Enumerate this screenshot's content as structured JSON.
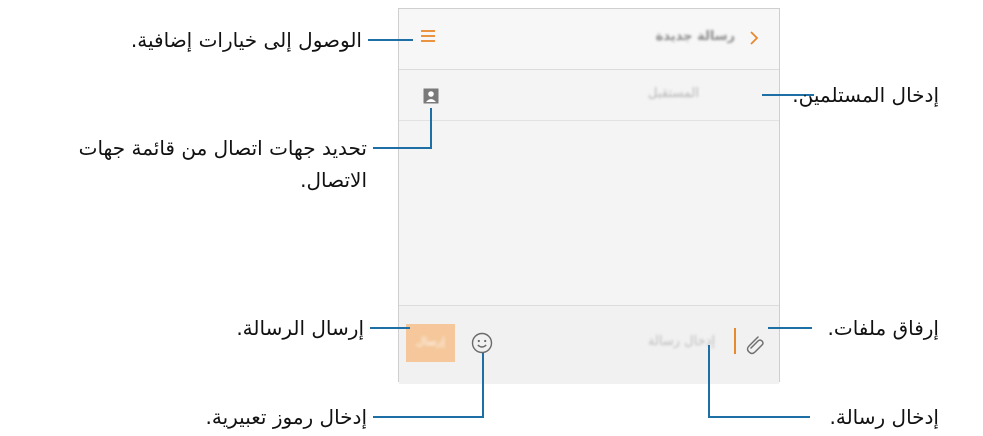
{
  "phone": {
    "toolbar": {
      "title": "رسالة جديدة",
      "back_icon": "chevron-right-icon",
      "menu_icon": "hamburger-menu-icon"
    },
    "recipient": {
      "placeholder": "المستقبل",
      "contact_icon": "contact-picker-icon"
    },
    "compose": {
      "placeholder": "إدخال رسالة",
      "attach_icon": "paperclip-icon",
      "emoji_icon": "smiley-icon",
      "send_label": "إرسال"
    }
  },
  "callouts": {
    "menu": "الوصول إلى خيارات إضافية.",
    "recipients": "إدخال المستلمين.",
    "contacts_line1": "تحديد جهات اتصال من قائمة جهات",
    "contacts_line2": "الاتصال.",
    "attach": "إرفاق ملفات.",
    "send": "إرسال الرسالة.",
    "emoji": "إدخال رموز تعبيرية.",
    "message": "إدخال رسالة."
  },
  "colors": {
    "accent": "#e8892d",
    "send_button": "#f5c79a",
    "leader": "#1d6fa5"
  }
}
